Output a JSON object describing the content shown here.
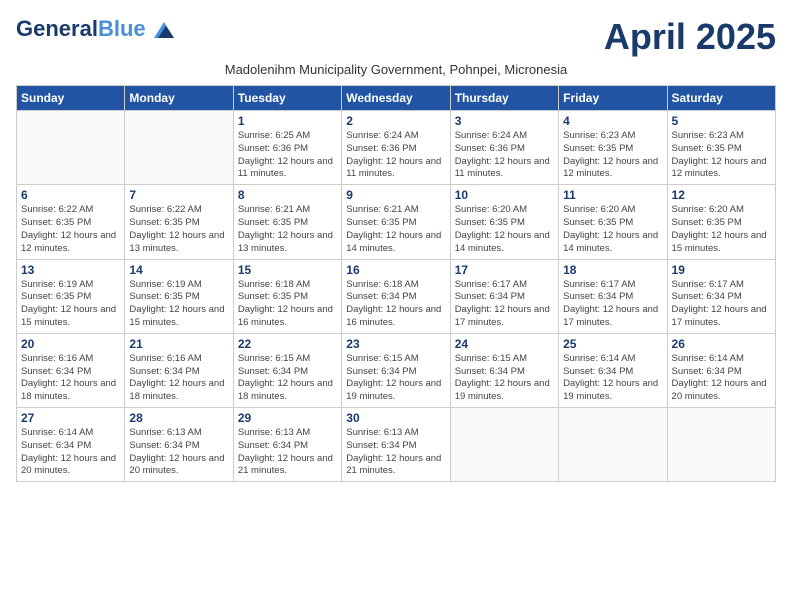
{
  "header": {
    "logo_line1_dark": "General",
    "logo_line1_blue": "Blue",
    "month_title": "April 2025",
    "subtitle": "Madolenihm Municipality Government, Pohnpei, Micronesia"
  },
  "weekdays": [
    "Sunday",
    "Monday",
    "Tuesday",
    "Wednesday",
    "Thursday",
    "Friday",
    "Saturday"
  ],
  "weeks": [
    [
      {
        "day": "",
        "info": ""
      },
      {
        "day": "",
        "info": ""
      },
      {
        "day": "1",
        "info": "Sunrise: 6:25 AM\nSunset: 6:36 PM\nDaylight: 12 hours and 11 minutes."
      },
      {
        "day": "2",
        "info": "Sunrise: 6:24 AM\nSunset: 6:36 PM\nDaylight: 12 hours and 11 minutes."
      },
      {
        "day": "3",
        "info": "Sunrise: 6:24 AM\nSunset: 6:36 PM\nDaylight: 12 hours and 11 minutes."
      },
      {
        "day": "4",
        "info": "Sunrise: 6:23 AM\nSunset: 6:35 PM\nDaylight: 12 hours and 12 minutes."
      },
      {
        "day": "5",
        "info": "Sunrise: 6:23 AM\nSunset: 6:35 PM\nDaylight: 12 hours and 12 minutes."
      }
    ],
    [
      {
        "day": "6",
        "info": "Sunrise: 6:22 AM\nSunset: 6:35 PM\nDaylight: 12 hours and 12 minutes."
      },
      {
        "day": "7",
        "info": "Sunrise: 6:22 AM\nSunset: 6:35 PM\nDaylight: 12 hours and 13 minutes."
      },
      {
        "day": "8",
        "info": "Sunrise: 6:21 AM\nSunset: 6:35 PM\nDaylight: 12 hours and 13 minutes."
      },
      {
        "day": "9",
        "info": "Sunrise: 6:21 AM\nSunset: 6:35 PM\nDaylight: 12 hours and 14 minutes."
      },
      {
        "day": "10",
        "info": "Sunrise: 6:20 AM\nSunset: 6:35 PM\nDaylight: 12 hours and 14 minutes."
      },
      {
        "day": "11",
        "info": "Sunrise: 6:20 AM\nSunset: 6:35 PM\nDaylight: 12 hours and 14 minutes."
      },
      {
        "day": "12",
        "info": "Sunrise: 6:20 AM\nSunset: 6:35 PM\nDaylight: 12 hours and 15 minutes."
      }
    ],
    [
      {
        "day": "13",
        "info": "Sunrise: 6:19 AM\nSunset: 6:35 PM\nDaylight: 12 hours and 15 minutes."
      },
      {
        "day": "14",
        "info": "Sunrise: 6:19 AM\nSunset: 6:35 PM\nDaylight: 12 hours and 15 minutes."
      },
      {
        "day": "15",
        "info": "Sunrise: 6:18 AM\nSunset: 6:35 PM\nDaylight: 12 hours and 16 minutes."
      },
      {
        "day": "16",
        "info": "Sunrise: 6:18 AM\nSunset: 6:34 PM\nDaylight: 12 hours and 16 minutes."
      },
      {
        "day": "17",
        "info": "Sunrise: 6:17 AM\nSunset: 6:34 PM\nDaylight: 12 hours and 17 minutes."
      },
      {
        "day": "18",
        "info": "Sunrise: 6:17 AM\nSunset: 6:34 PM\nDaylight: 12 hours and 17 minutes."
      },
      {
        "day": "19",
        "info": "Sunrise: 6:17 AM\nSunset: 6:34 PM\nDaylight: 12 hours and 17 minutes."
      }
    ],
    [
      {
        "day": "20",
        "info": "Sunrise: 6:16 AM\nSunset: 6:34 PM\nDaylight: 12 hours and 18 minutes."
      },
      {
        "day": "21",
        "info": "Sunrise: 6:16 AM\nSunset: 6:34 PM\nDaylight: 12 hours and 18 minutes."
      },
      {
        "day": "22",
        "info": "Sunrise: 6:15 AM\nSunset: 6:34 PM\nDaylight: 12 hours and 18 minutes."
      },
      {
        "day": "23",
        "info": "Sunrise: 6:15 AM\nSunset: 6:34 PM\nDaylight: 12 hours and 19 minutes."
      },
      {
        "day": "24",
        "info": "Sunrise: 6:15 AM\nSunset: 6:34 PM\nDaylight: 12 hours and 19 minutes."
      },
      {
        "day": "25",
        "info": "Sunrise: 6:14 AM\nSunset: 6:34 PM\nDaylight: 12 hours and 19 minutes."
      },
      {
        "day": "26",
        "info": "Sunrise: 6:14 AM\nSunset: 6:34 PM\nDaylight: 12 hours and 20 minutes."
      }
    ],
    [
      {
        "day": "27",
        "info": "Sunrise: 6:14 AM\nSunset: 6:34 PM\nDaylight: 12 hours and 20 minutes."
      },
      {
        "day": "28",
        "info": "Sunrise: 6:13 AM\nSunset: 6:34 PM\nDaylight: 12 hours and 20 minutes."
      },
      {
        "day": "29",
        "info": "Sunrise: 6:13 AM\nSunset: 6:34 PM\nDaylight: 12 hours and 21 minutes."
      },
      {
        "day": "30",
        "info": "Sunrise: 6:13 AM\nSunset: 6:34 PM\nDaylight: 12 hours and 21 minutes."
      },
      {
        "day": "",
        "info": ""
      },
      {
        "day": "",
        "info": ""
      },
      {
        "day": "",
        "info": ""
      }
    ]
  ]
}
